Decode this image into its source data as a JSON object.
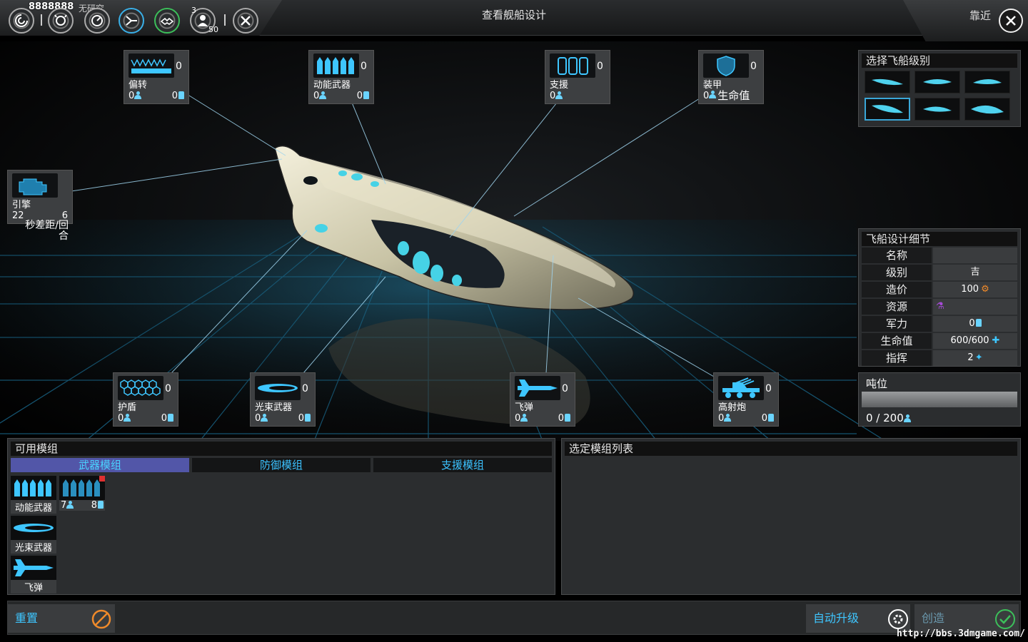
{
  "topbar": {
    "resources": "8888888",
    "research_label": "无研究",
    "badge_3": "3",
    "badge_50": "50",
    "title": "查看舰船设计",
    "zoom_label": "靠近"
  },
  "slots": {
    "deflect": {
      "name": "偏转",
      "count": "0",
      "s1": "0",
      "s2": "0"
    },
    "kinetic": {
      "name": "动能武器",
      "count": "0",
      "s1": "0",
      "s2": "0"
    },
    "support": {
      "name": "支援",
      "count": "0",
      "s1": "0"
    },
    "armor": {
      "name": "装甲",
      "count": "0",
      "s1": "0",
      "s2": "生命值"
    },
    "engine": {
      "name": "引擎",
      "v1": "22",
      "v2": "6",
      "unit": "秒差距/回合"
    },
    "shield": {
      "name": "护盾",
      "count": "0",
      "s1": "0",
      "s2": "0"
    },
    "beam": {
      "name": "光束武器",
      "count": "0",
      "s1": "0",
      "s2": "0"
    },
    "missile": {
      "name": "飞弹",
      "count": "0",
      "s1": "0",
      "s2": "0"
    },
    "artillery": {
      "name": "高射炮",
      "count": "0",
      "s1": "0",
      "s2": "0"
    }
  },
  "class_panel": {
    "title": "选择飞船级别"
  },
  "details": {
    "title": "飞船设计细节",
    "rows": [
      {
        "k": "名称",
        "v": ""
      },
      {
        "k": "级别",
        "v": "吉"
      },
      {
        "k": "造价",
        "v": "100"
      },
      {
        "k": "资源",
        "v": ""
      },
      {
        "k": "军力",
        "v": "0"
      },
      {
        "k": "生命值",
        "v": "600/600"
      },
      {
        "k": "指挥",
        "v": "2"
      }
    ]
  },
  "tonnage": {
    "title": "吨位",
    "value": "0 / 200"
  },
  "modules": {
    "title": "可用模组",
    "tabs": [
      "武器模组",
      "防御模组",
      "支援模组"
    ],
    "items": [
      {
        "name": "动能武器"
      },
      {
        "name": "",
        "s1": "7",
        "s2": "8"
      },
      {
        "name": "光束武器"
      },
      {
        "name": "飞弹"
      }
    ]
  },
  "selected": {
    "title": "选定模组列表"
  },
  "buttons": {
    "reset": "重置",
    "auto_upgrade": "自动升级",
    "create": "创造"
  },
  "watermark": "http://bbs.3dmgame.com/",
  "colors": {
    "accent": "#3ec6ff",
    "tab_active": "#5256a8",
    "panel": "#2b2d2f"
  }
}
